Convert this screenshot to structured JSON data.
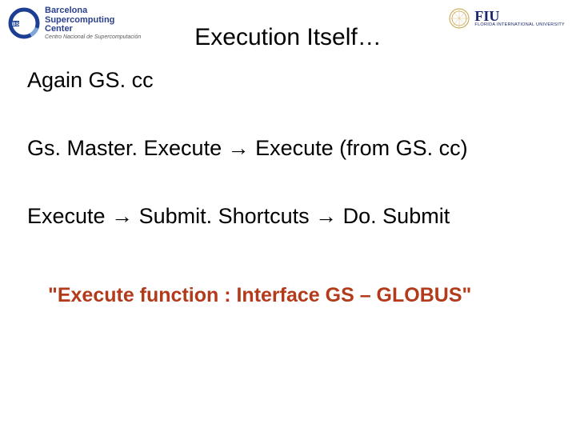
{
  "logos": {
    "bsc": {
      "name": "Barcelona Supercomputing Center",
      "sub": "Centro Nacional de Supercomputación"
    },
    "fiu": {
      "name": "FIU",
      "sub": "FLORIDA INTERNATIONAL UNIVERSITY"
    }
  },
  "title": "Execution Itself…",
  "subtitle": "Again GS. cc",
  "line1": "Gs. Master. Execute → Execute (from GS. cc)",
  "line2": "Execute → Submit. Shortcuts → Do. Submit",
  "callout": "\"Execute function : Interface GS – GLOBUS\""
}
